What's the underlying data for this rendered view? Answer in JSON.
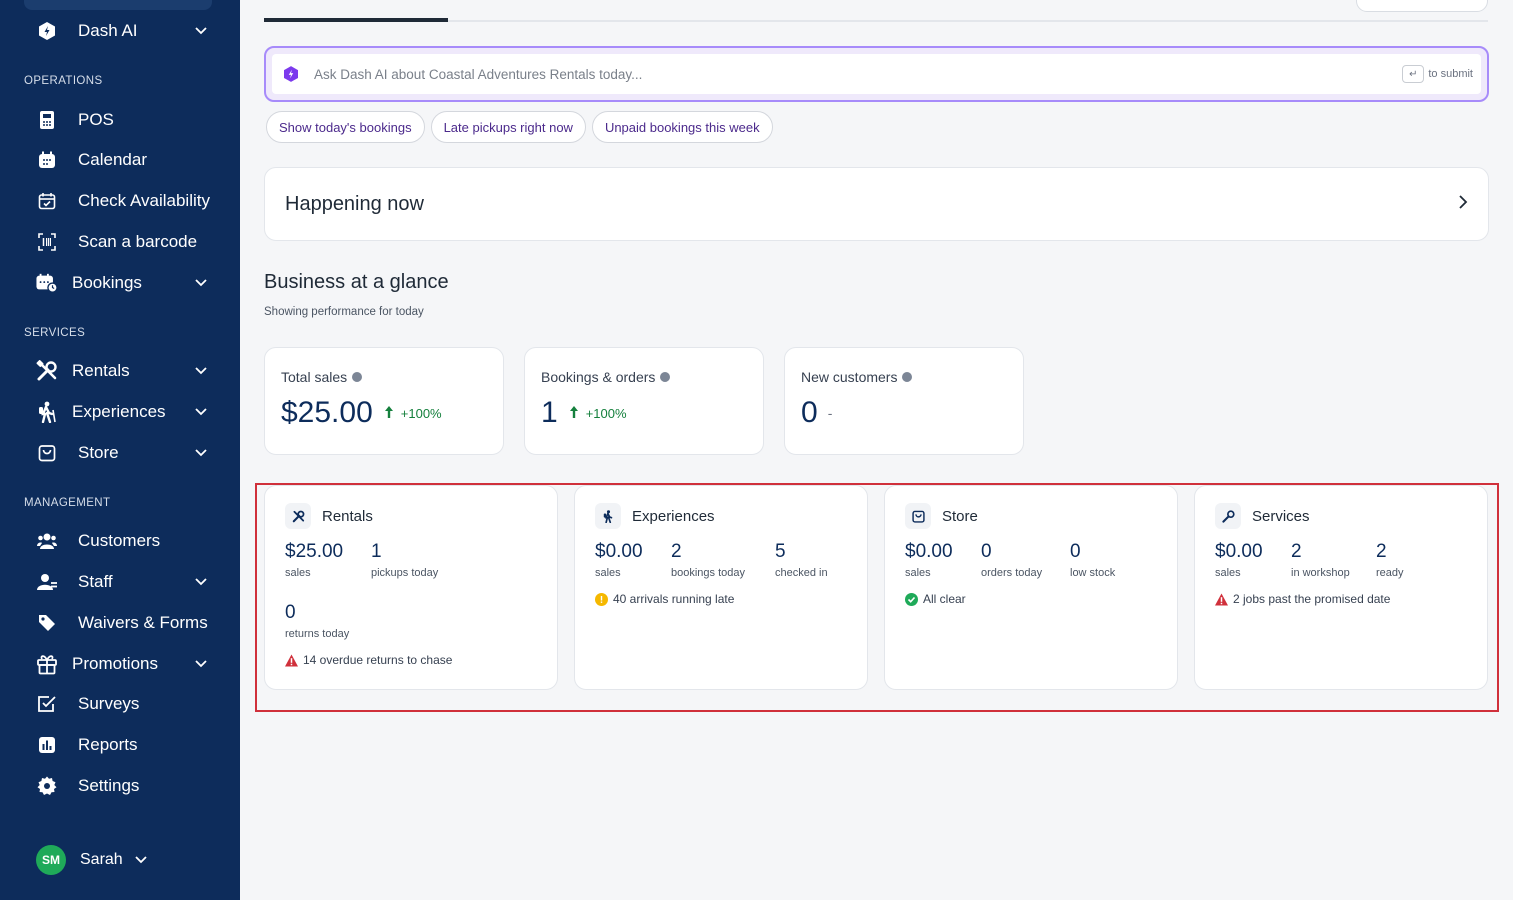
{
  "sidebar": {
    "dash_ai": "Dash AI",
    "sections": {
      "operations": "OPERATIONS",
      "services": "SERVICES",
      "management": "MANAGEMENT"
    },
    "items": {
      "pos": "POS",
      "calendar": "Calendar",
      "check_availability": "Check Availability",
      "scan_barcode": "Scan a barcode",
      "bookings": "Bookings",
      "rentals": "Rentals",
      "experiences": "Experiences",
      "store": "Store",
      "customers": "Customers",
      "staff": "Staff",
      "waivers": "Waivers & Forms",
      "promotions": "Promotions",
      "surveys": "Surveys",
      "reports": "Reports",
      "settings": "Settings"
    },
    "user": {
      "initials": "SM",
      "name": "Sarah"
    }
  },
  "ask": {
    "placeholder": "Ask Dash AI about Coastal Adventures Rentals today...",
    "enter_key": "↵",
    "submit_hint": "to submit"
  },
  "chips": [
    "Show today's bookings",
    "Late pickups right now",
    "Unpaid bookings this week"
  ],
  "happening": {
    "title": "Happening now"
  },
  "glance": {
    "title": "Business at a glance",
    "subtitle": "Showing performance for today",
    "kpis": [
      {
        "label": "Total sales",
        "value": "$25.00",
        "change": "+100%"
      },
      {
        "label": "Bookings & orders",
        "value": "1",
        "change": "+100%"
      },
      {
        "label": "New customers",
        "value": "0",
        "change": "-"
      }
    ]
  },
  "services": {
    "rentals": {
      "title": "Rentals",
      "metrics": [
        {
          "value": "$25.00",
          "label": "sales"
        },
        {
          "value": "1",
          "label": "pickups today"
        },
        {
          "value": "0",
          "label": "returns today"
        }
      ],
      "note": "14 overdue returns to chase"
    },
    "experiences": {
      "title": "Experiences",
      "metrics": [
        {
          "value": "$0.00",
          "label": "sales"
        },
        {
          "value": "2",
          "label": "bookings today"
        },
        {
          "value": "5",
          "label": "checked in"
        }
      ],
      "note": "40 arrivals running late"
    },
    "store": {
      "title": "Store",
      "metrics": [
        {
          "value": "$0.00",
          "label": "sales"
        },
        {
          "value": "0",
          "label": "orders today"
        },
        {
          "value": "0",
          "label": "low stock"
        }
      ],
      "note": "All clear"
    },
    "services": {
      "title": "Services",
      "metrics": [
        {
          "value": "$0.00",
          "label": "sales"
        },
        {
          "value": "2",
          "label": "in workshop"
        },
        {
          "value": "2",
          "label": "ready"
        }
      ],
      "note": "2 jobs past the promised date"
    }
  },
  "colors": {
    "sidebar_bg": "#0d2c5b",
    "accent_purple": "#a78bfa",
    "positive": "#15803d",
    "warning": "#d0303b",
    "caution": "#f5b800",
    "ok": "#1faa59"
  }
}
